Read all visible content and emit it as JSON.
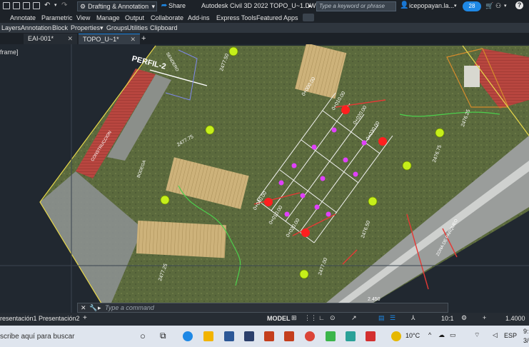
{
  "titlebar": {
    "workspace": "Drafting & Annotation",
    "share": "Share",
    "app_title": "Autodesk Civil 3D 2022   TOPO_U~1.DWG",
    "search_placeholder": "Type a keyword or phrase",
    "user": "icepopayan.la...",
    "notifications": "28"
  },
  "ribbon_tabs": [
    "Annotate",
    "Parametric",
    "View",
    "Manage",
    "Output",
    "Collaborate",
    "Add-ins",
    "Express Tools",
    "Featured Apps"
  ],
  "ribbon_panels": [
    "Layers",
    "Annotation",
    "Block",
    "Properties",
    "Groups",
    "Utilities",
    "Clipboard"
  ],
  "file_tabs": [
    {
      "label": "EAI-001*",
      "active": false
    },
    {
      "label": "TOPO_U~1*",
      "active": true
    }
  ],
  "viewport": {
    "side_label": "frame]",
    "profile_label": "PERFIL-2",
    "elevations": [
      "2477.50",
      "2477.75",
      "2476.25",
      "2476.75",
      "2477.00",
      "2476.50",
      "2477.25",
      "2.450"
    ],
    "offset_labels": [
      "0+010.00",
      "0+020.00",
      "0+030.00",
      "0+040.00",
      "0+010.00",
      "0+020.00",
      "0+000.00"
    ],
    "building_labels": [
      "CONSTRUCCION",
      "SENDERO",
      "BODEGA"
    ],
    "zone_label": "ZONA DE PARQUEO"
  },
  "command": {
    "placeholder": "Type a command"
  },
  "layouts": {
    "tabs": [
      "resentación1",
      "Presentación2"
    ],
    "model": "MODEL",
    "scale": "10:1",
    "zoom": "1.4000"
  },
  "taskbar": {
    "search": "scribe aquí para buscar",
    "temperature": "10°C",
    "language": "ESP",
    "time": "9:1",
    "date": "3/0"
  },
  "colors": {
    "accent": "#1e88e5",
    "grass": "#4f5a3a",
    "roof_red": "#b5473f"
  }
}
